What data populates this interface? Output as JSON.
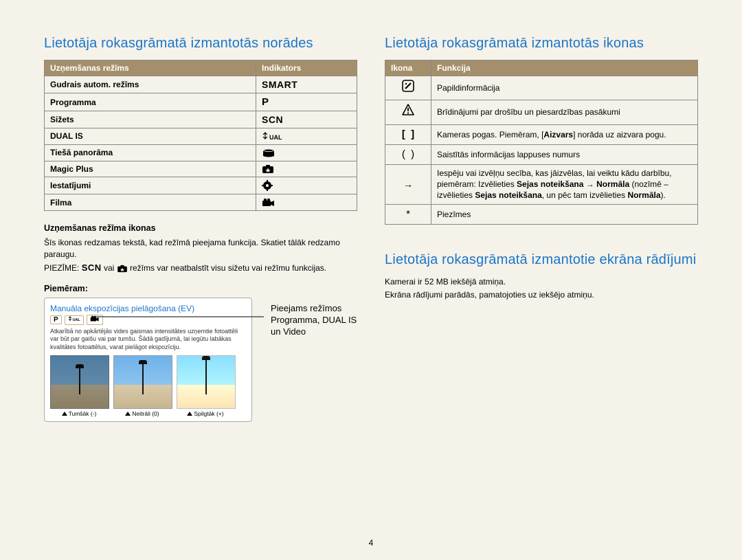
{
  "leftHeading": "Lietotāja rokasgrāmatā izmantotās norādes",
  "modes": {
    "headers": [
      "Uzņemšanas režīms",
      "Indikators"
    ],
    "rows": [
      {
        "name": "Gudrais autom. režīms",
        "indicatorText": "SMART"
      },
      {
        "name": "Programma",
        "indicatorText": "P"
      },
      {
        "name": "Sižets",
        "indicatorText": "SCN"
      },
      {
        "name": "DUAL IS",
        "indicatorText": ""
      },
      {
        "name": "Tiešā panorāma",
        "indicatorText": ""
      },
      {
        "name": "Magic Plus",
        "indicatorText": ""
      },
      {
        "name": "Iestatījumi",
        "indicatorText": ""
      },
      {
        "name": "Filma",
        "indicatorText": ""
      }
    ]
  },
  "subhead1": "Uzņemšanas režīma ikonas",
  "para1": "Šīs ikonas redzamas tekstā, kad režīmā pieejama funkcija. Skatiet tālāk redzamo paraugu.",
  "noteLabel": "PIEZĪME:",
  "notePart1": " vai ",
  "notePart2": " režīms var neatbalstīt visu sižetu vai režīmu funkcijas.",
  "exampleLabel": "Piemēram:",
  "example": {
    "title": "Manuāla ekspozīcijas pielāgošana (EV)",
    "tagP": "P",
    "text": "Atkarībā no apkārtējās vides gaismas intensitātes uzņemtie fotoattēli var būt par gaišu vai par tumšu. Šādā gadījumā, lai iegūtu labākas kvalitātes fotoattēlus, varat pielāgot ekspozīciju.",
    "thumbs": [
      "Tumšāk (-)",
      "Neitrāli (0)",
      "Spilgtāk (+)"
    ]
  },
  "annotation": "Pieejams režīmos Programma, DUAL IS un Video",
  "rightHeading1": "Lietotāja rokasgrāmatā izmantotās ikonas",
  "icons": {
    "headers": [
      "Ikona",
      "Funkcija"
    ],
    "rows": [
      {
        "iconGlyph": "info-note",
        "text": "Papildinformācija"
      },
      {
        "iconGlyph": "warning",
        "text": "Brīdinājumi par drošību un piesardzības pasākumi"
      },
      {
        "iconGlyph": "brackets",
        "textParts": [
          "Kameras pogas. Piemēram, [",
          "Aizvars",
          "] norāda uz aizvara pogu."
        ]
      },
      {
        "iconGlyph": "parens",
        "text": "Saistītās informācijas lappuses numurs"
      },
      {
        "iconGlyph": "arrow",
        "textParts": [
          "Iespēju vai izvēļņu secība, kas jāizvēlas, lai veiktu kādu darbību, piemēram: Izvēlieties ",
          "Sejas noteikšana",
          " → ",
          "Normāla",
          " (nozīmē – izvēlieties ",
          "Sejas noteikšana",
          ", un pēc tam izvēlieties ",
          "Normāla",
          ")."
        ]
      },
      {
        "iconGlyph": "asterisk",
        "text": "Piezīmes"
      }
    ]
  },
  "rightHeading2": "Lietotāja rokasgrāmatā izmantotie ekrāna rādījumi",
  "para2a": "Kamerai ir 52 MB iekšējā atmiņa.",
  "para2b": "Ekrāna rādījumi parādās, pamatojoties uz iekšējo atmiņu.",
  "pageNumber": "4"
}
